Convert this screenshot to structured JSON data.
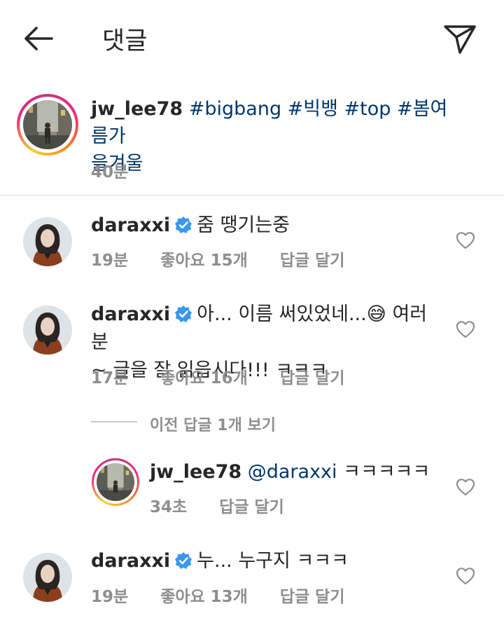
{
  "header": {
    "title": "댓글",
    "back_icon": "arrow-left-icon",
    "send_icon": "paper-plane-icon"
  },
  "post": {
    "username": "jw_lee78",
    "caption_tags": [
      "#bigbang",
      "#빅뱅",
      "#top",
      "#봄여름가을겨울"
    ],
    "caption_tag_lines": [
      "#bigbang #빅뱅 #top #봄여름가",
      "을겨울"
    ],
    "time": "40분"
  },
  "comments": [
    {
      "username": "daraxxi",
      "verified": true,
      "text": "줌 땡기는중",
      "time": "19분",
      "likes": "좋아요 15개",
      "reply_label": "답글 달기"
    },
    {
      "username": "daraxxi",
      "verified": true,
      "text_line1": "아... 이름 써있었네...😅 여러분",
      "text_line2": "~ 글을 잘 읽읍시다!!! ㅋㅋㅋ",
      "time": "17분",
      "likes": "좋아요 16개",
      "reply_label": "답글 달기",
      "view_previous_replies": "이전 답글 1개 보기",
      "reply": {
        "username": "jw_lee78",
        "mention": "@daraxxi",
        "text": "ㅋㅋㅋㅋㅋ",
        "time": "34초",
        "reply_label": "답글 달기"
      }
    },
    {
      "username": "daraxxi",
      "verified": true,
      "text": "누... 누구지 ㅋㅋㅋ",
      "time": "19분",
      "likes": "좋아요 13개",
      "reply_label": "답글 달기"
    }
  ],
  "colors": {
    "hashtag": "#00376b",
    "meta": "#8e8e8e",
    "verified": "#3897f0",
    "divider": "#dbdbdb"
  }
}
